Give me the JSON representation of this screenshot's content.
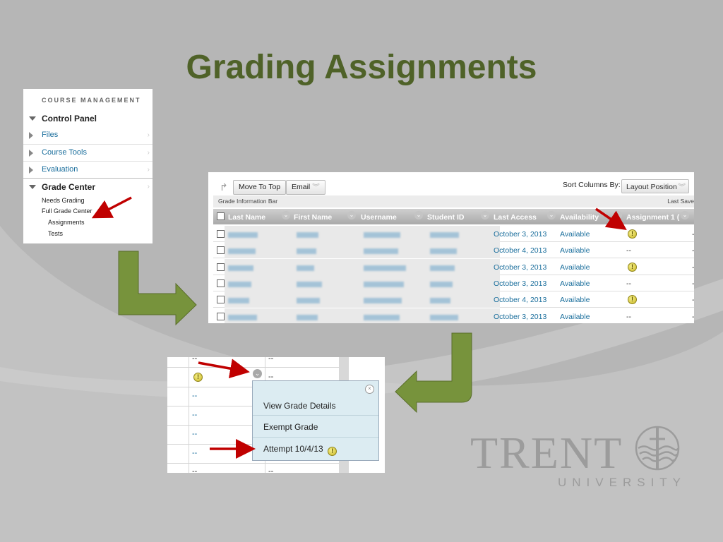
{
  "slide": {
    "title": "Grading Assignments"
  },
  "course_management": {
    "header": "COURSE MANAGEMENT",
    "control_panel": "Control Panel",
    "items": [
      "Files",
      "Course Tools",
      "Evaluation"
    ],
    "grade_center": "Grade Center",
    "grade_center_items": [
      "Needs Grading",
      "Full Grade Center"
    ],
    "full_grade_center_items": [
      "Assignments",
      "Tests"
    ]
  },
  "grade_center": {
    "move_to_top": "Move To Top",
    "email": "Email",
    "sort_label": "Sort Columns By:",
    "sort_value": "Layout Position",
    "info_bar": "Grade Information Bar",
    "last_saved": "Last Save",
    "columns": [
      "Last Name",
      "First Name",
      "Username",
      "Student ID",
      "Last Access",
      "Availability",
      "Assignment 1 ("
    ],
    "rows": [
      {
        "last_access": "October 3, 2013",
        "availability": "Available",
        "assignment_1": "needs-grading"
      },
      {
        "last_access": "October 4, 2013",
        "availability": "Available",
        "assignment_1": "--"
      },
      {
        "last_access": "October 3, 2013",
        "availability": "Available",
        "assignment_1": "needs-grading"
      },
      {
        "last_access": "October 3, 2013",
        "availability": "Available",
        "assignment_1": "--"
      },
      {
        "last_access": "October 4, 2013",
        "availability": "Available",
        "assignment_1": "needs-grading"
      },
      {
        "last_access": "October 3, 2013",
        "availability": "Available",
        "assignment_1": "--"
      }
    ]
  },
  "context_menu": {
    "dash": "--",
    "items": [
      "View Grade Details",
      "Exempt Grade",
      "Attempt 10/4/13"
    ]
  },
  "logo": {
    "name": "TRENT",
    "subtitle": "UNIVERSITY"
  },
  "colors": {
    "title": "#4f6228",
    "arrow_green": "#77933c",
    "pointer_red": "#c00000",
    "link_blue": "#1a6e9c"
  }
}
